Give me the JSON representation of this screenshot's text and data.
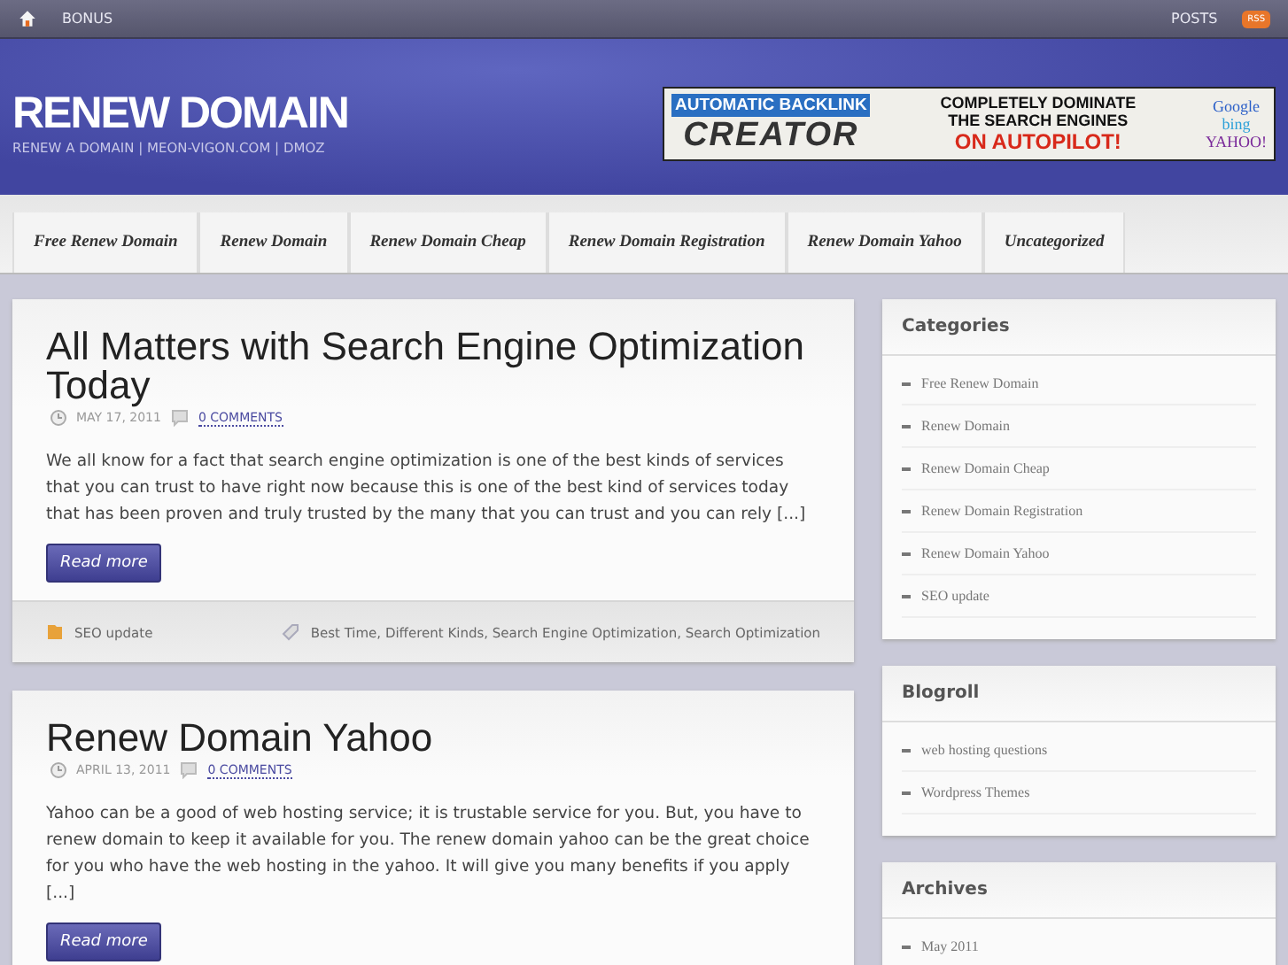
{
  "topbar": {
    "left_links": [
      "BONUS"
    ],
    "right_links": [
      "POSTS"
    ],
    "rss": "RSS"
  },
  "header": {
    "title": "RENEW DOMAIN",
    "tagline": "RENEW A DOMAIN | MEON-VIGON.COM | DMOZ",
    "banner": {
      "left_top": "AUTOMATIC BACKLINK",
      "left_big": "CREATOR",
      "mid_lines": [
        "COMPLETELY DOMINATE",
        "THE SEARCH ENGINES"
      ],
      "mid_accent": "ON AUTOPILOT!",
      "engines": [
        "Google",
        "bing",
        "YAHOO!"
      ]
    }
  },
  "nav": [
    "Free Renew Domain",
    "Renew Domain",
    "Renew Domain Cheap",
    "Renew Domain Registration",
    "Renew Domain Yahoo",
    "Uncategorized"
  ],
  "posts": [
    {
      "title": "All Matters with Search Engine Optimization Today",
      "date": "MAY 17, 2011",
      "comments": "0 COMMENTS",
      "excerpt": "We all know for a fact that search engine optimization is one of the best kinds of services that you can trust to have right now because this is one of the best kind of services today that has been proven and truly trusted by the many that you can trust and you can rely [...]",
      "button": "Read more",
      "category": "SEO update",
      "tags": "Best Time, Different Kinds, Search Engine Optimization, Search Optimization"
    },
    {
      "title": "Renew Domain Yahoo",
      "date": "APRIL 13, 2011",
      "comments": "0 COMMENTS",
      "excerpt": "Yahoo can be a good of web hosting service; it is trustable service for you. But, you have to renew domain to keep it available for you. The renew domain yahoo can be the great choice for you who have the web hosting in the yahoo. It will give you many benefits if you apply [...]",
      "button": "Read more"
    }
  ],
  "sidebar": [
    {
      "title": "Categories",
      "items": [
        "Free Renew Domain",
        "Renew Domain",
        "Renew Domain Cheap",
        "Renew Domain Registration",
        "Renew Domain Yahoo",
        "SEO update"
      ]
    },
    {
      "title": "Blogroll",
      "items": [
        "web hosting questions",
        "Wordpress Themes"
      ]
    },
    {
      "title": "Archives",
      "items": [
        "May 2011"
      ]
    }
  ]
}
